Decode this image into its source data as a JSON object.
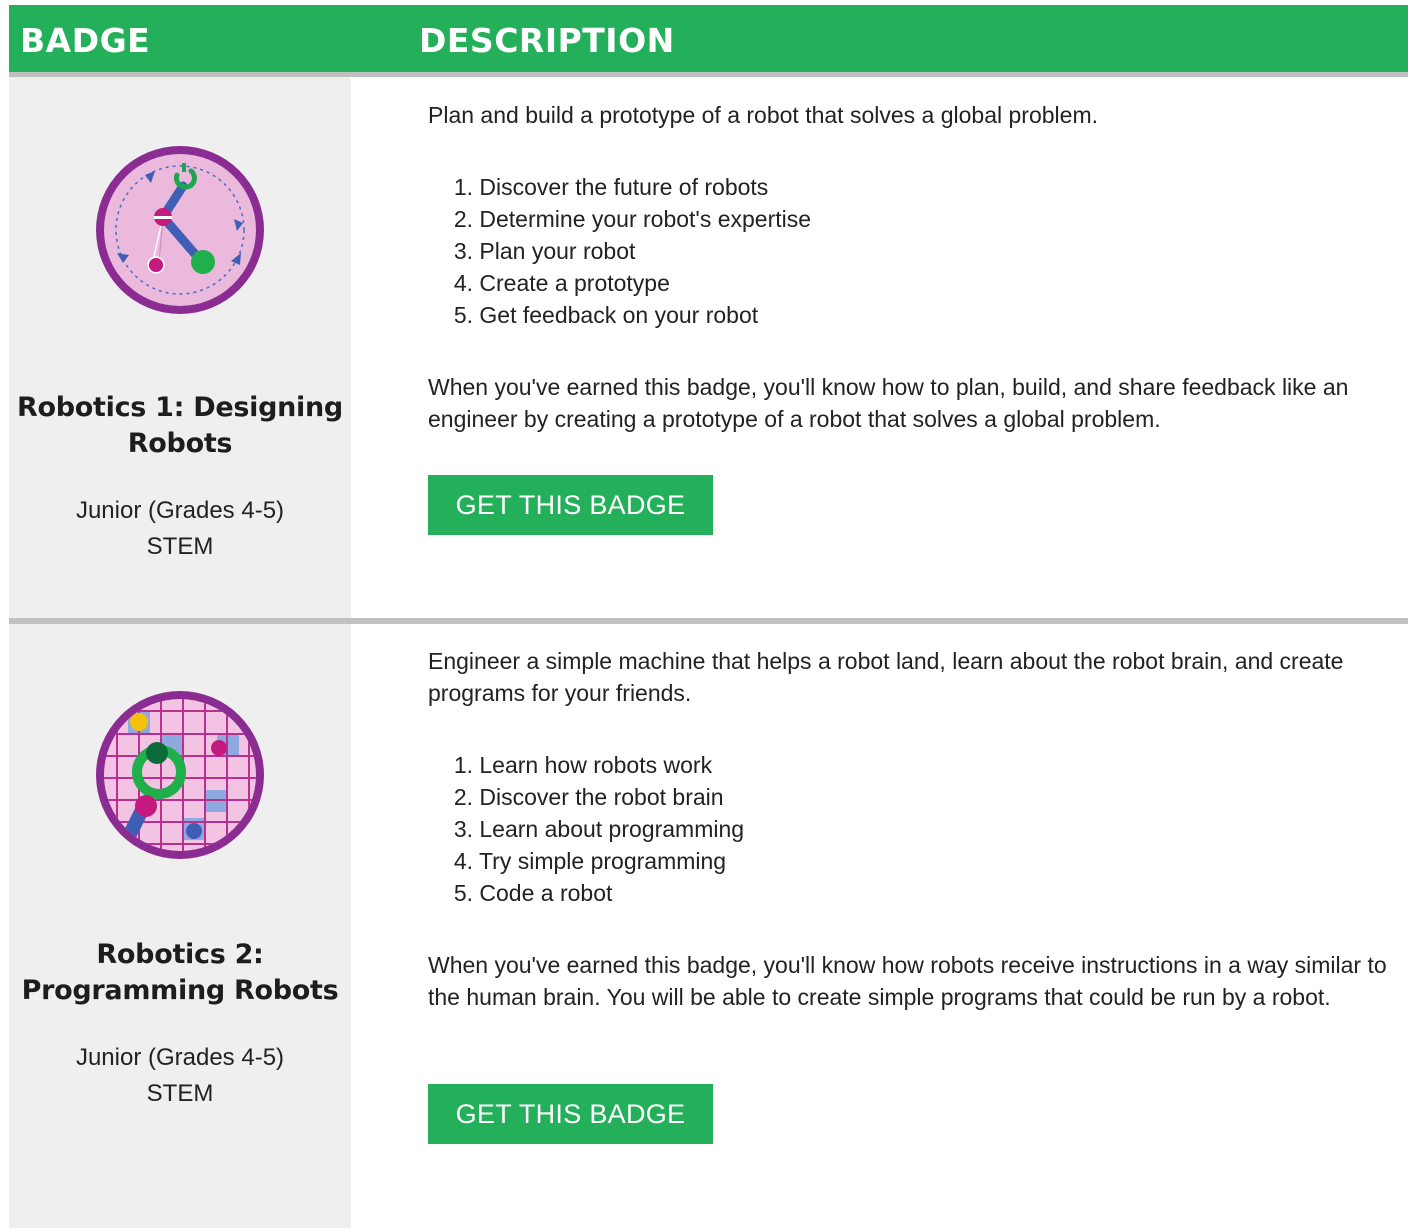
{
  "header": {
    "badge_label": "BADGE",
    "description_label": "DESCRIPTION"
  },
  "colors": {
    "brand_green": "#24b05a",
    "badge_cell_bg": "#efefef",
    "divider": "#c2c2c2",
    "badge_ring_purple": "#8b2c92",
    "badge_fill_pink": "#eab9dc"
  },
  "badges": [
    {
      "title_line1": "Robotics 1: Designing",
      "title_line2": "Robots",
      "level": "Junior (Grades 4-5)",
      "category": "STEM",
      "icon": "robot-arm-icon",
      "intro": "Plan and build a prototype of a robot that solves a global problem.",
      "steps": [
        {
          "num": "1.",
          "text": "Discover the future of robots"
        },
        {
          "num": "2.",
          "text": "Determine your robot's expertise"
        },
        {
          "num": "3.",
          "text": "Plan your robot"
        },
        {
          "num": "4.",
          "text": "Create a prototype"
        },
        {
          "num": "5.",
          "text": "Get feedback on your robot"
        }
      ],
      "outcome": "When you've earned this badge, you'll know how to plan, build, and share feedback like an engineer by creating a prototype of a robot that solves a global problem.",
      "button_label": "GET THIS BADGE"
    },
    {
      "title_line1": "Robotics 2:",
      "title_line2": "Programming Robots",
      "level": "Junior (Grades 4-5)",
      "category": "STEM",
      "icon": "robot-grid-icon",
      "intro": "Engineer a simple machine that helps a robot land, learn about the robot brain, and create programs for your friends.",
      "steps": [
        {
          "num": "1.",
          "text": "Learn how robots work"
        },
        {
          "num": "2.",
          "text": "Discover the robot brain"
        },
        {
          "num": "3.",
          "text": "Learn about programming"
        },
        {
          "num": "4.",
          "text": "Try simple programming"
        },
        {
          "num": "5.",
          "text": "Code a robot"
        }
      ],
      "outcome": "When you've earned this badge, you'll know how robots receive instructions in a way similar to the human brain. You will be able to create simple programs that could be run by a robot.",
      "button_label": "GET THIS BADGE"
    }
  ]
}
